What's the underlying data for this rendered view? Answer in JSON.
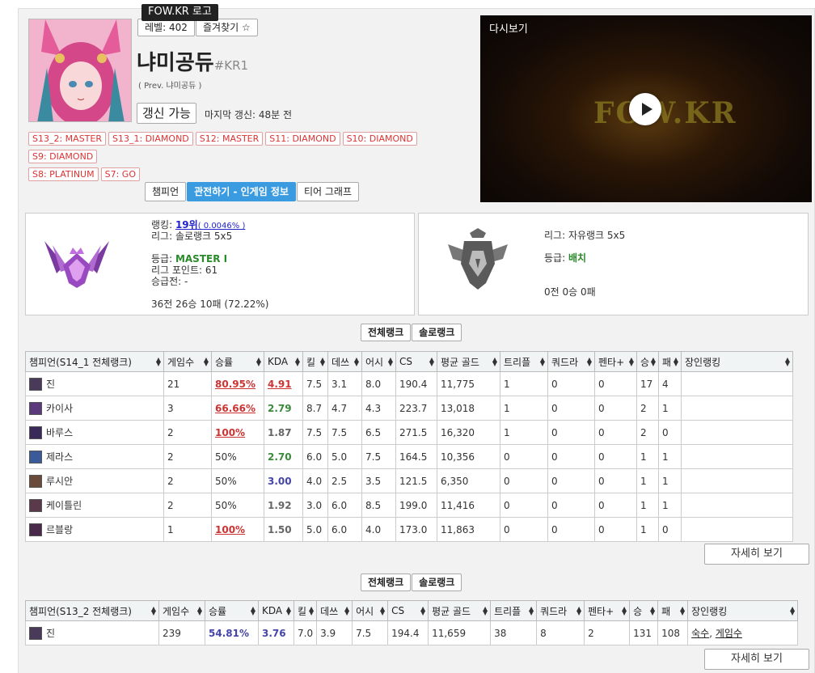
{
  "tooltip": "FOW.KR 로고",
  "profile": {
    "level_label": "레벨: 402",
    "favorite_label": "즐겨찾기 ☆",
    "name": "냐미공듀",
    "tag": "#KR1",
    "prev_name": "( Prev. 냐미공듀 )",
    "renew_label": "갱신 가능",
    "last_update": "마지막 갱신: 48분 전"
  },
  "tiers": [
    "S13_2: MASTER",
    "S13_1: DIAMOND",
    "S12: MASTER",
    "S11: DIAMOND",
    "S10: DIAMOND",
    "S9: DIAMOND",
    "S8: PLATINUM",
    "S7: GO"
  ],
  "tabs": [
    {
      "label": "챔피언",
      "active": false
    },
    {
      "label": "관전하기 - 인게임 정보",
      "active": true
    },
    {
      "label": "티어 그래프",
      "active": false
    }
  ],
  "video": {
    "title": "다시보기",
    "watermark": "FOW.KR"
  },
  "solo": {
    "ranking_prefix": "랭킹: ",
    "ranking": "19위",
    "ranking_pct": "( 0.0046% )",
    "league": "리그: 솔로랭크 5x5",
    "grade_prefix": "등급: ",
    "grade": "MASTER I",
    "points": "리그 포인트: 61",
    "promo": "승급전: -",
    "record": "36전 26승 10패 (72.22%)"
  },
  "flex": {
    "league": "리그: 자유랭크 5x5",
    "grade_prefix": "등급: ",
    "grade": "배치",
    "record": "0전 0승 0패"
  },
  "switch": {
    "all": "전체랭크",
    "solo": "솔로랭크"
  },
  "table1": {
    "headers": [
      "챔피언(S14_1 전체랭크)",
      "게임수",
      "승률",
      "KDA",
      "킬",
      "데쓰",
      "어시",
      "CS",
      "평균 골드",
      "트리플",
      "쿼드라",
      "펜타+",
      "승",
      "패",
      "장인랭킹"
    ],
    "rows": [
      {
        "name": "진",
        "games": "21",
        "wr": "80.95%",
        "kda": "4.91",
        "kda_cls": "r",
        "k": "7.5",
        "d": "3.1",
        "a": "8.0",
        "cs": "190.4",
        "gold": "11,775",
        "triple": "1",
        "quadra": "0",
        "penta": "0",
        "w": "17",
        "l": "4",
        "color": "#4a3a5a"
      },
      {
        "name": "카이사",
        "games": "3",
        "wr": "66.66%",
        "kda": "2.79",
        "kda_cls": "g",
        "k": "8.7",
        "d": "4.7",
        "a": "4.3",
        "cs": "223.7",
        "gold": "13,018",
        "triple": "1",
        "quadra": "0",
        "penta": "0",
        "w": "2",
        "l": "1",
        "color": "#5a3a7a"
      },
      {
        "name": "바루스",
        "games": "2",
        "wr": "100%",
        "kda": "1.87",
        "kda_cls": "n",
        "k": "7.5",
        "d": "7.5",
        "a": "6.5",
        "cs": "271.5",
        "gold": "16,320",
        "triple": "1",
        "quadra": "0",
        "penta": "0",
        "w": "2",
        "l": "0",
        "color": "#3a2a5a"
      },
      {
        "name": "제라스",
        "games": "2",
        "wr": "50%",
        "kda": "2.70",
        "kda_cls": "g",
        "k": "6.0",
        "d": "5.0",
        "a": "7.5",
        "cs": "164.5",
        "gold": "10,356",
        "triple": "0",
        "quadra": "0",
        "penta": "0",
        "w": "1",
        "l": "1",
        "color": "#3a5a9a"
      },
      {
        "name": "루시안",
        "games": "2",
        "wr": "50%",
        "kda": "3.00",
        "kda_cls": "b",
        "k": "4.0",
        "d": "2.5",
        "a": "3.5",
        "cs": "121.5",
        "gold": "6,350",
        "triple": "0",
        "quadra": "0",
        "penta": "0",
        "w": "1",
        "l": "1",
        "color": "#6a4a3a"
      },
      {
        "name": "케이틀린",
        "games": "2",
        "wr": "50%",
        "kda": "1.92",
        "kda_cls": "n",
        "k": "3.0",
        "d": "6.0",
        "a": "8.5",
        "cs": "199.0",
        "gold": "11,416",
        "triple": "0",
        "quadra": "0",
        "penta": "0",
        "w": "1",
        "l": "1",
        "color": "#5a3a4a"
      },
      {
        "name": "르블랑",
        "games": "1",
        "wr": "100%",
        "kda": "1.50",
        "kda_cls": "n",
        "k": "5.0",
        "d": "6.0",
        "a": "4.0",
        "cs": "173.0",
        "gold": "11,863",
        "triple": "0",
        "quadra": "0",
        "penta": "0",
        "w": "1",
        "l": "0",
        "color": "#4a2a4a"
      }
    ]
  },
  "more_label": "자세히 보기",
  "table2": {
    "headers": [
      "챔피언(S13_2 전체랭크)",
      "게임수",
      "승률",
      "KDA",
      "킬",
      "데쓰",
      "어시",
      "CS",
      "평균 골드",
      "트리플",
      "쿼드라",
      "펜타+",
      "승",
      "패",
      "장인랭킹"
    ],
    "row": {
      "name": "진",
      "games": "239",
      "wr": "54.81%",
      "kda": "3.76",
      "k": "7.0",
      "d": "3.9",
      "a": "7.5",
      "cs": "194.4",
      "gold": "11,659",
      "triple": "38",
      "quadra": "8",
      "penta": "2",
      "w": "131",
      "l": "108",
      "rank1": "숙수",
      "rank_sep": ", ",
      "rank2": "게임수",
      "color": "#4a3a5a"
    }
  }
}
